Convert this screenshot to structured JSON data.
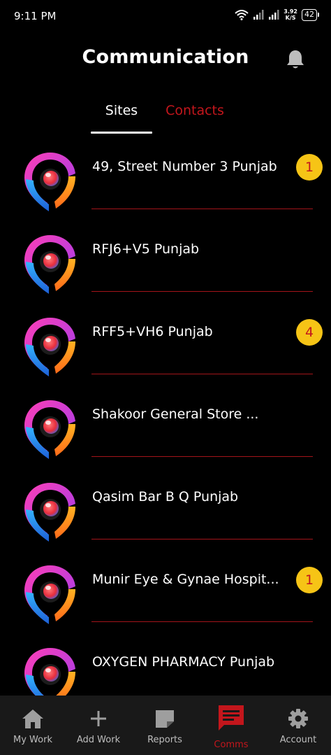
{
  "status_bar": {
    "time": "9:11 PM",
    "net_speed_value": "3.92",
    "net_speed_unit": "K/S",
    "battery": "42"
  },
  "header": {
    "title": "Communication",
    "bell_icon": "bell-icon"
  },
  "tabs": [
    {
      "label": "Sites",
      "active": true
    },
    {
      "label": "Contacts",
      "active": false
    }
  ],
  "sites": [
    {
      "name": "49, Street Number 3 Punjab",
      "unread": "1"
    },
    {
      "name": "RFJ6+V5 Punjab",
      "unread": ""
    },
    {
      "name": "RFF5+VH6 Punjab",
      "unread": "4"
    },
    {
      "name": "Shakoor General Store ...",
      "unread": ""
    },
    {
      "name": "Qasim Bar B Q Punjab",
      "unread": ""
    },
    {
      "name": "Munir Eye & Gynae Hospit...",
      "unread": "1"
    },
    {
      "name": "OXYGEN PHARMACY Punjab",
      "unread": ""
    }
  ],
  "bottom_nav": [
    {
      "label": "My Work",
      "icon": "home-icon"
    },
    {
      "label": "Add Work",
      "icon": "plus-icon"
    },
    {
      "label": "Reports",
      "icon": "note-icon"
    },
    {
      "label": "Comms",
      "icon": "chat-icon",
      "active": true
    },
    {
      "label": "Account",
      "icon": "gear-icon"
    }
  ],
  "colors": {
    "accent": "#c3161c",
    "badge": "#f6c416",
    "background": "#000000",
    "nav_background": "#191919"
  }
}
